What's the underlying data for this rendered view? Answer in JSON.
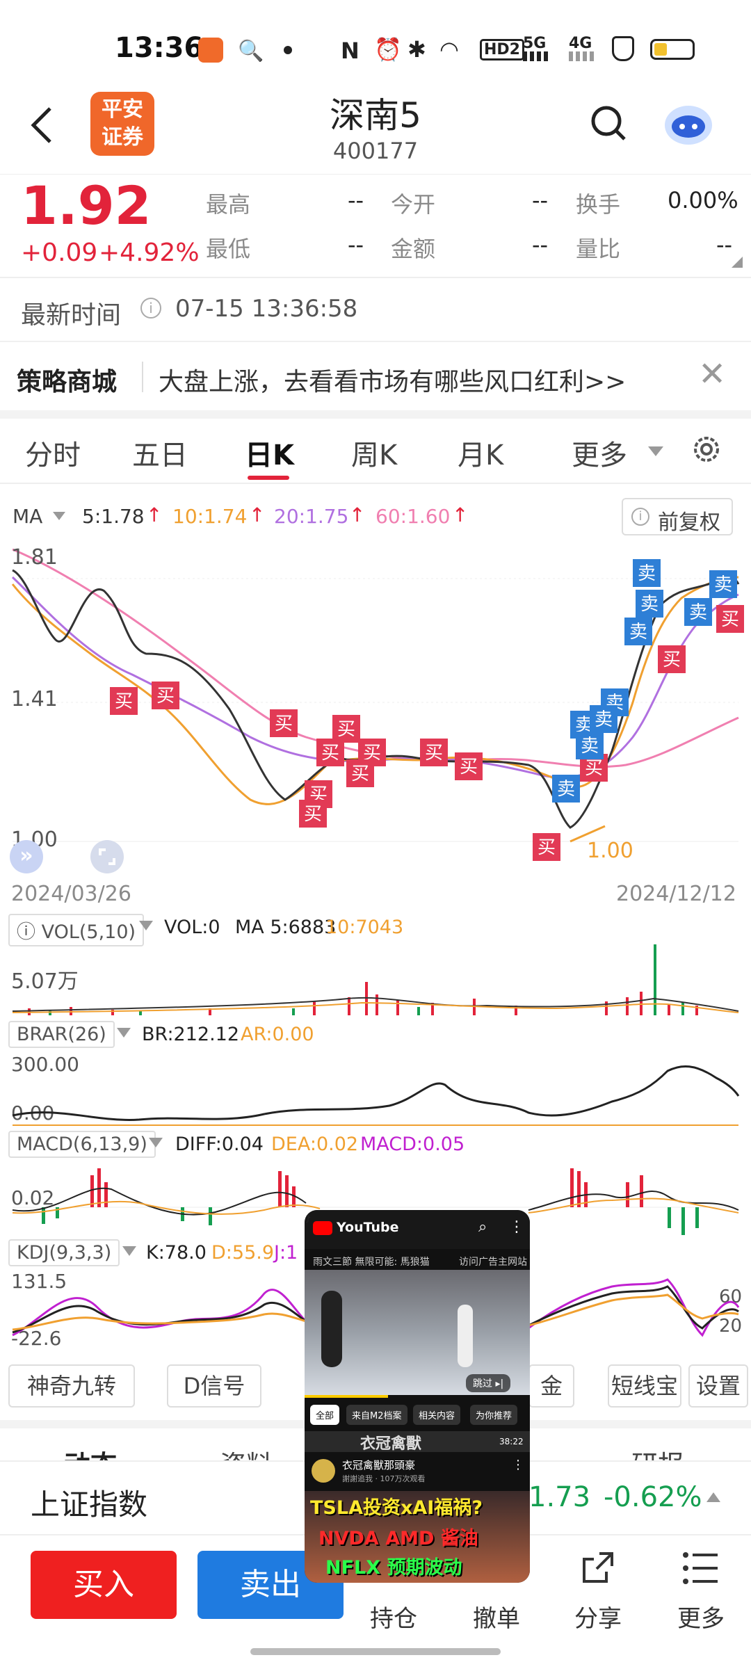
{
  "status_bar": {
    "time": "13:36",
    "network": "5G",
    "network2": "4G",
    "hd": "HD2"
  },
  "header": {
    "logo_line1": "平安",
    "logo_line2": "证券",
    "stock_name": "深南5",
    "stock_code": "400177",
    "back_icon": "chevron-left-icon",
    "search_icon": "search-icon",
    "assistant_icon": "robot-icon"
  },
  "quote": {
    "price": "1.92",
    "change": "+0.09",
    "change_pct": "+4.92%",
    "fields": [
      {
        "label": "最高",
        "value": "--"
      },
      {
        "label": "今开",
        "value": "--"
      },
      {
        "label": "换手",
        "value": "0.00%"
      },
      {
        "label": "最低",
        "value": "--"
      },
      {
        "label": "金额",
        "value": "--"
      },
      {
        "label": "量比",
        "value": "--"
      }
    ]
  },
  "latest_time": {
    "label": "最新时间",
    "value": "07-15 13:36:58"
  },
  "banner": {
    "title": "策略商城",
    "text": "大盘上涨，去看看市场有哪些风口红利>>"
  },
  "tabs": [
    "分时",
    "五日",
    "日K",
    "周K",
    "月K",
    "更多"
  ],
  "active_tab": "日K",
  "ma_bar": {
    "label": "MA",
    "ma5": "5:1.78",
    "ma10": "10:1.74",
    "ma20": "20:1.75",
    "ma60": "60:1.60",
    "adjust": "前复权"
  },
  "kline": {
    "y_top": "1.81",
    "y_mid": "1.41",
    "y_low": "1.00",
    "low_marker": "1.00",
    "date_start": "2024/03/26",
    "date_end": "2024/12/12",
    "buy_label": "买",
    "sell_label": "卖"
  },
  "vol": {
    "label": "VOL(5,10)",
    "stat_vol": "VOL:0",
    "stat_ma5": "MA 5:6883",
    "stat_10": "10:7043",
    "y_top": "5.07万"
  },
  "brar": {
    "label": "BRAR(26)",
    "br": "BR:212.12",
    "ar": "AR:0.00",
    "y_top": "300.00",
    "y_low": "0.00"
  },
  "macd": {
    "label": "MACD(6,13,9)",
    "diff": "DIFF:0.04",
    "dea": "DEA:0.02",
    "macd": "MACD:0.05",
    "y_val": "0.02"
  },
  "kdj": {
    "label": "KDJ(9,3,3)",
    "k": "K:78.0",
    "d": "D:55.9",
    "j": "J:1",
    "y_top": "131.5",
    "y_low": "-22.6",
    "r1": "60",
    "r2": "20"
  },
  "tools": [
    "神奇九转",
    "D信号",
    "金",
    "短线宝",
    "设置"
  ],
  "partial_tabs": [
    "动态",
    "资料",
    "研报"
  ],
  "index_bar": {
    "name": "上证指数",
    "value": "1.73",
    "pct": "-0.62%"
  },
  "bottom_nav": {
    "buy": "买入",
    "sell": "卖出",
    "position": "持仓",
    "cancel": "撤单",
    "share": "分享",
    "more": "更多"
  },
  "pip_video": {
    "app": "YouTube",
    "subtitle": "雨文三節 無限可能: 馬狼猫",
    "ad_note": "访问广告主网站",
    "skip": "跳过",
    "chips": [
      "全部",
      "来自M2档案",
      "相关内容",
      "为你推荐"
    ],
    "banner_text": "衣冠禽獸",
    "duration": "38:22",
    "video_title": "衣冠禽獸那頭豪",
    "channel": "謝謝追我 · 107万次观看",
    "thumb_line1": "TSLA投资xAI福祸?",
    "thumb_line2": "NVDA  AMD  酱油",
    "thumb_line3": "NFLX  预期波动"
  },
  "colors": {
    "up": "#e2233a",
    "down": "#159e50",
    "ma5": "#333333",
    "ma10": "#f0a030",
    "ma20": "#b070e0",
    "ma60": "#f07fb0",
    "buy_btn": "#ef2020",
    "sell_btn": "#1f7be0"
  }
}
